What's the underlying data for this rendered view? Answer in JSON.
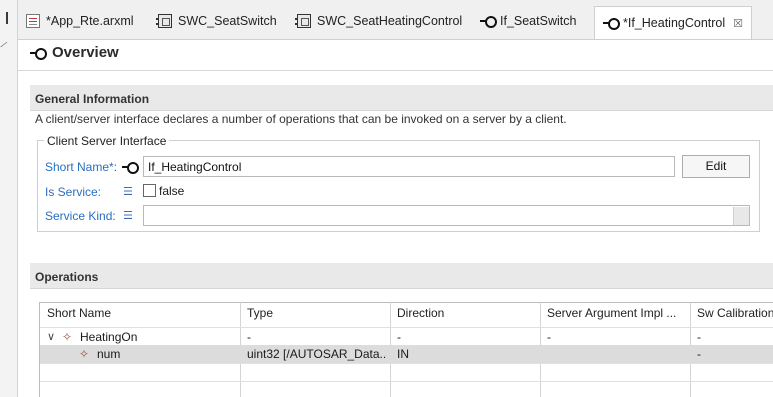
{
  "tabs": [
    {
      "label": "*App_Rte.arxml",
      "icon": "file-icon"
    },
    {
      "label": "SWC_SeatSwitch",
      "icon": "swc-icon"
    },
    {
      "label": "SWC_SeatHeatingControl",
      "icon": "swc-icon"
    },
    {
      "label": "If_SeatSwitch",
      "icon": "interface-icon"
    },
    {
      "label": "*If_HeatingControl",
      "icon": "interface-icon",
      "active": true,
      "close": "☒"
    }
  ],
  "overview": {
    "title": "Overview"
  },
  "general": {
    "header": "General Information",
    "description": "A client/server interface declares a number of operations that can be invoked on a server by a client.",
    "group_title": "Client Server Interface",
    "short_name_label": "Short Name*:",
    "short_name_value": "If_HeatingControl",
    "edit_label": "Edit",
    "is_service_label": "Is Service:",
    "is_service_value": "false",
    "service_kind_label": "Service Kind:",
    "service_kind_value": ""
  },
  "operations": {
    "header": "Operations",
    "columns": [
      "Short Name",
      "Type",
      "Direction",
      "Server Argument Impl ...",
      "Sw Calibration"
    ],
    "rows": [
      {
        "short_name": "HeatingOn",
        "type": "-",
        "direction": "-",
        "server_arg": "-",
        "sw_cal": "-",
        "expander": "∨"
      },
      {
        "short_name": "num",
        "type": "uint32 [/AUTOSAR_Data...",
        "direction": "IN",
        "server_arg": "",
        "sw_cal": "-"
      }
    ]
  },
  "colors": {
    "label_blue": "#2a6fc0",
    "selection": "#dcdcdc",
    "operation_icon": "#a0524f"
  }
}
